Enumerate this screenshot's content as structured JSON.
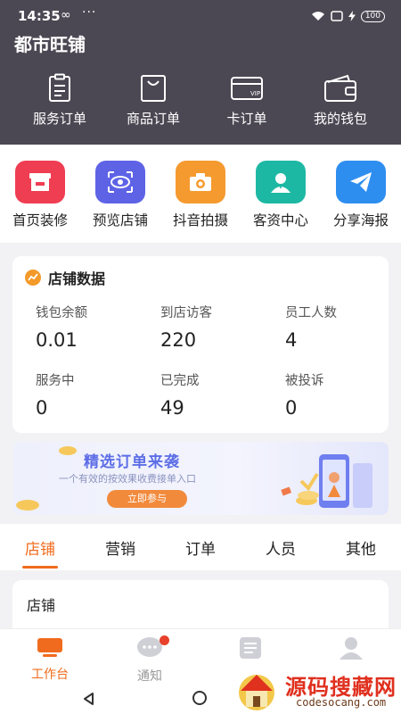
{
  "status_bar": {
    "time": "14:35",
    "battery": "100"
  },
  "header": {
    "title": "都市旺铺"
  },
  "head_nav": [
    {
      "label": "服务订单",
      "icon": "clipboard-icon"
    },
    {
      "label": "商品订单",
      "icon": "shopping-bag-icon"
    },
    {
      "label": "卡订单",
      "icon": "vip-card-icon",
      "card_text": "VIP"
    },
    {
      "label": "我的钱包",
      "icon": "wallet-icon"
    }
  ],
  "quick_actions": [
    {
      "label": "首页装修",
      "icon": "storefront-icon",
      "color": "#ef3d52"
    },
    {
      "label": "预览店铺",
      "icon": "eye-icon",
      "color": "#5e63e6"
    },
    {
      "label": "抖音拍摄",
      "icon": "camera-icon",
      "color": "#f59a2f"
    },
    {
      "label": "客资中心",
      "icon": "person-icon",
      "color": "#1db8a4"
    },
    {
      "label": "分享海报",
      "icon": "paper-plane-icon",
      "color": "#2d8ef0"
    }
  ],
  "store_data": {
    "title": "店铺数据",
    "stats": [
      {
        "label": "钱包余额",
        "value": "0.01"
      },
      {
        "label": "到店访客",
        "value": "220"
      },
      {
        "label": "员工人数",
        "value": "4"
      },
      {
        "label": "服务中",
        "value": "0"
      },
      {
        "label": "已完成",
        "value": "49"
      },
      {
        "label": "被投诉",
        "value": "0"
      }
    ]
  },
  "banner": {
    "title": "精选订单来袭",
    "subtitle": "一个有效的按效果收费接单入口",
    "button": "立即参与"
  },
  "tabs": [
    {
      "label": "店铺",
      "active": true
    },
    {
      "label": "营销"
    },
    {
      "label": "订单"
    },
    {
      "label": "人员"
    },
    {
      "label": "其他"
    }
  ],
  "section": {
    "title": "店铺"
  },
  "bottom_nav": [
    {
      "label": "工作台",
      "icon": "monitor-icon",
      "active": true
    },
    {
      "label": "通知",
      "icon": "chat-bubble-icon"
    },
    {
      "label": "",
      "icon": "list-icon"
    },
    {
      "label": "",
      "icon": "user-icon"
    }
  ],
  "watermark": {
    "text": "源码搜藏网",
    "url": "codesocang.com"
  },
  "colors": {
    "accent": "#f06b1d",
    "header_bg": "#4b4853"
  }
}
